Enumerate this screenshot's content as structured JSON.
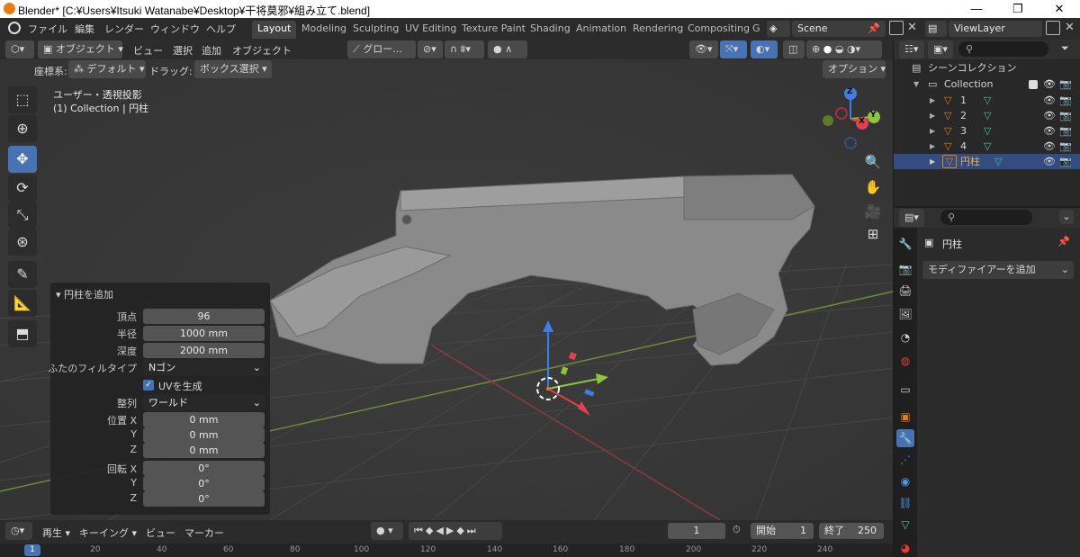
{
  "window": {
    "title": "Blender* [C:¥Users¥Itsuki Watanabe¥Desktop¥干将莫邪¥組み立て.blend]",
    "minimize": "—",
    "maximize": "❐",
    "close": "✕"
  },
  "menubar": {
    "menus": [
      "ファイル",
      "編集",
      "レンダー",
      "ウィンドウ",
      "ヘルプ"
    ],
    "workspaces": [
      "Layout",
      "Modeling",
      "Sculpting",
      "UV Editing",
      "Texture Paint",
      "Shading",
      "Animation",
      "Rendering",
      "Compositing",
      "G"
    ],
    "active_workspace": "Layout",
    "scene": "Scene",
    "view_layer": "ViewLayer"
  },
  "viewport_header": {
    "mode": "オブジェクト",
    "view": "ビュー",
    "select": "選択",
    "add": "追加",
    "object": "オブジェクト",
    "transform": "グロー...",
    "coord_label": "座標系:",
    "coord_value": "デフォルト",
    "drag_label": "ドラッグ:",
    "drag_value": "ボックス選択",
    "options": "オプション"
  },
  "viewport_info": {
    "line1": "ユーザー・透視投影",
    "line2": "(1) Collection | 円柱"
  },
  "gizmo": {
    "z": "Z",
    "y": "Y",
    "x": "X"
  },
  "redo_panel": {
    "title": "円柱を追加",
    "vertices_label": "頂点",
    "vertices": "96",
    "radius_label": "半径",
    "radius": "1000 mm",
    "depth_label": "深度",
    "depth": "2000 mm",
    "cap_label": "ふたのフィルタイプ",
    "cap": "Nゴン",
    "uv_label": "UVを生成",
    "uv_checked": true,
    "align_label": "整列",
    "align": "ワールド",
    "loc_label": "位置 X",
    "loc_x": "0 mm",
    "y_label": "Y",
    "loc_y": "0 mm",
    "z_label": "Z",
    "loc_z": "0 mm",
    "rot_label": "回転 X",
    "rot_x": "0°",
    "rot_y": "0°",
    "rot_z": "0°"
  },
  "outliner": {
    "scene_collection": "シーンコレクション",
    "collection": "Collection",
    "items": [
      {
        "name": "1",
        "selected": false
      },
      {
        "name": "2",
        "selected": false
      },
      {
        "name": "3",
        "selected": false
      },
      {
        "name": "4",
        "selected": false
      },
      {
        "name": "円柱",
        "selected": true
      }
    ]
  },
  "properties": {
    "object_name": "円柱",
    "add_modifier": "モディファイアーを追加"
  },
  "timeline": {
    "playback": "再生",
    "keying": "キーイング",
    "view": "ビュー",
    "marker": "マーカー",
    "current_frame": "1",
    "start_label": "開始",
    "start": "1",
    "end_label": "終了",
    "end": "250",
    "ticks": [
      "1",
      "20",
      "40",
      "60",
      "80",
      "100",
      "120",
      "140",
      "160",
      "180",
      "200",
      "220",
      "240"
    ]
  },
  "colors": {
    "accent": "#4772b3",
    "selected_row": "#334d80",
    "orange": "#e87d0d",
    "axis_x": "#e0404f",
    "axis_y": "#8cc63e",
    "axis_z": "#3d7fe0"
  }
}
